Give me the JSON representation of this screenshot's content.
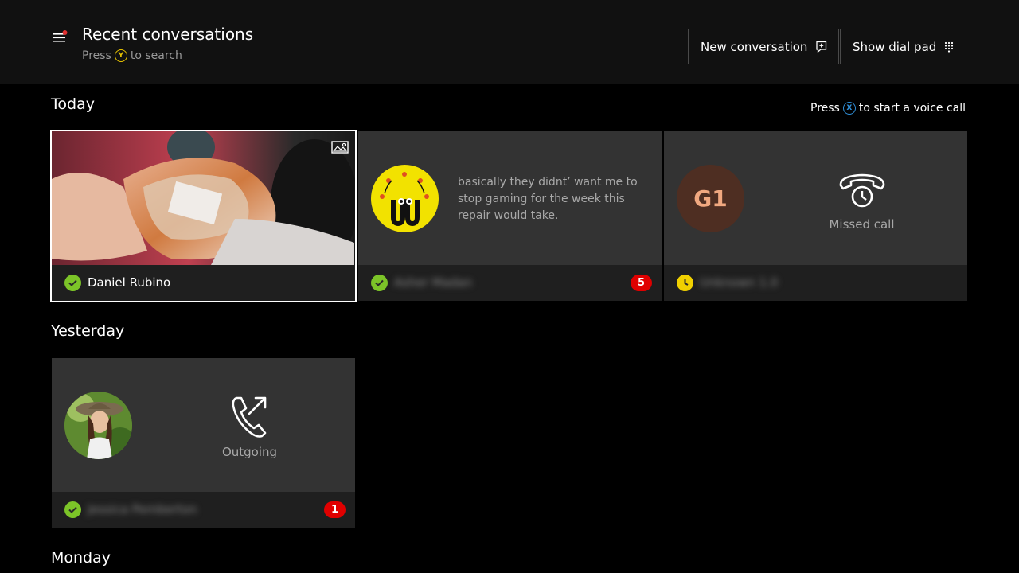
{
  "header": {
    "title": "Recent conversations",
    "search_hint_prefix": "Press",
    "search_hint_button": "Y",
    "search_hint_suffix": "to search",
    "new_conversation_label": "New conversation",
    "dial_pad_label": "Show dial pad"
  },
  "sections": {
    "today": "Today",
    "yesterday": "Yesterday",
    "monday": "Monday"
  },
  "voice_hint": {
    "prefix": "Press",
    "button": "X",
    "suffix": "to start a voice call"
  },
  "conversations": [
    {
      "name": "Daniel Rubino",
      "status": "online",
      "type": "image",
      "icon": "image-icon",
      "focused": true
    },
    {
      "name": "Asher Madan",
      "status": "online",
      "type": "message",
      "preview": "basically they didnt’ want me to stop gaming for the week this repair would take.",
      "badge": "5"
    },
    {
      "name": "Unknown 1.0",
      "status": "away",
      "type": "missed-call",
      "avatar_text": "G1",
      "call_label": "Missed call",
      "icon": "missed-call-icon"
    },
    {
      "name": "Jessica Pemberton",
      "status": "online",
      "type": "outgoing-call",
      "call_label": "Outgoing",
      "icon": "outgoing-call-icon",
      "badge": "1"
    }
  ],
  "colors": {
    "online": "#7cc428",
    "away": "#f0d000",
    "badge": "#e00000",
    "tile": "#333333",
    "footer": "#1f1f1f",
    "notification_dot": "#e03030"
  }
}
